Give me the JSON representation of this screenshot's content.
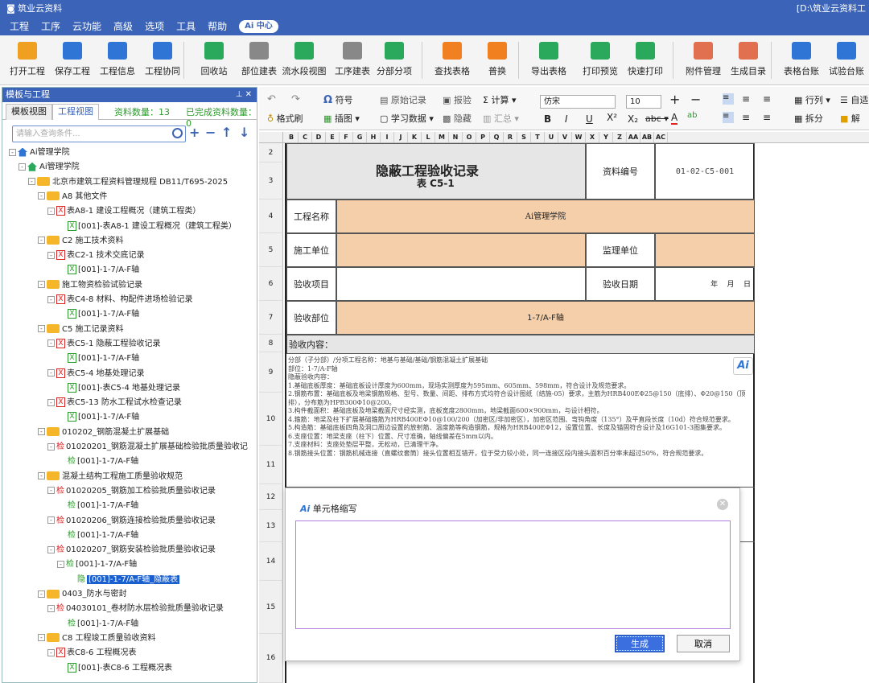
{
  "app": {
    "title": "筑业云资料",
    "path": "[D:\\筑业云资料工"
  },
  "menu": [
    "工程",
    "工序",
    "云功能",
    "高级",
    "选项",
    "工具",
    "帮助"
  ],
  "ai_center": "Ai 中心",
  "ribbon": [
    "打开工程",
    "保存工程",
    "工程信息",
    "工程协同",
    "回收站",
    "部位建表",
    "流水段视图",
    "工序建表",
    "分部分项",
    "查找表格",
    "普换",
    "导出表格",
    "打印预览",
    "快速打印",
    "附件管理",
    "生成目录",
    "表格台账",
    "试验台账"
  ],
  "left": {
    "title": "模板与工程",
    "tabs": [
      "模板视图",
      "工程视图"
    ],
    "count_label": "资料数量：13",
    "done_label": "已完成资料数量：0",
    "search_placeholder": "请输入查询条件...",
    "tree": [
      {
        "level": 0,
        "icon": "house-b",
        "tg": "-",
        "text": "Ai管理学院"
      },
      {
        "level": 1,
        "icon": "house",
        "tg": "-",
        "text": "Ai管理学院"
      },
      {
        "level": 2,
        "icon": "folder",
        "tg": "-",
        "text": "北京市建筑工程资料管理规程 DB11/T695-2025"
      },
      {
        "level": 3,
        "icon": "folder",
        "tg": "-",
        "text": "A8 其他文件"
      },
      {
        "level": 4,
        "icon": "x",
        "tg": "-",
        "text": "表A8-1 建设工程概况（建筑工程类）"
      },
      {
        "level": 5,
        "icon": "xg",
        "tg": "",
        "text": "[001]-表A8-1 建设工程概况（建筑工程类）"
      },
      {
        "level": 3,
        "icon": "folder",
        "tg": "-",
        "text": "C2 施工技术资料"
      },
      {
        "level": 4,
        "icon": "x",
        "tg": "-",
        "text": "表C2-1 技术交底记录"
      },
      {
        "level": 5,
        "icon": "xg",
        "tg": "",
        "text": "[001]-1-7/A-F轴"
      },
      {
        "level": 3,
        "icon": "folder",
        "tg": "-",
        "text": "施工物资检验试验记录"
      },
      {
        "level": 4,
        "icon": "x",
        "tg": "-",
        "text": "表C4-8 材料、构配件进场检验记录"
      },
      {
        "level": 5,
        "icon": "xg",
        "tg": "",
        "text": "[001]-1-7/A-F轴"
      },
      {
        "level": 3,
        "icon": "folder",
        "tg": "-",
        "text": "C5 施工记录资料"
      },
      {
        "level": 4,
        "icon": "x",
        "tg": "-",
        "text": "表C5-1 隐蔽工程验收记录"
      },
      {
        "level": 5,
        "icon": "xg",
        "tg": "",
        "text": "[001]-1-7/A-F轴"
      },
      {
        "level": 4,
        "icon": "x",
        "tg": "-",
        "text": "表C5-4 地基处理记录"
      },
      {
        "level": 5,
        "icon": "xg",
        "tg": "",
        "text": "[001]-表C5-4 地基处理记录"
      },
      {
        "level": 4,
        "icon": "x",
        "tg": "-",
        "text": "表C5-13 防水工程试水检查记录"
      },
      {
        "level": 5,
        "icon": "xg",
        "tg": "",
        "text": "[001]-1-7/A-F轴"
      },
      {
        "level": 3,
        "icon": "folder",
        "tg": "-",
        "text": "010202_钢筋混凝土扩展基础"
      },
      {
        "level": 4,
        "icon": "jian",
        "tg": "-",
        "text": "01020201_钢筋混凝土扩展基础检验批质量验收记"
      },
      {
        "level": 5,
        "icon": "jiang",
        "tg": "",
        "text": "[001]-1-7/A-F轴"
      },
      {
        "level": 3,
        "icon": "folder",
        "tg": "-",
        "text": "混凝土结构工程施工质量验收规范"
      },
      {
        "level": 4,
        "icon": "jian",
        "tg": "-",
        "text": "01020205_钢筋加工检验批质量验收记录"
      },
      {
        "level": 5,
        "icon": "jiang",
        "tg": "",
        "text": "[001]-1-7/A-F轴"
      },
      {
        "level": 4,
        "icon": "jian",
        "tg": "-",
        "text": "01020206_钢筋连接检验批质量验收记录"
      },
      {
        "level": 5,
        "icon": "jiang",
        "tg": "",
        "text": "[001]-1-7/A-F轴"
      },
      {
        "level": 4,
        "icon": "jian",
        "tg": "-",
        "text": "01020207_钢筋安装检验批质量验收记录"
      },
      {
        "level": 5,
        "icon": "jiang",
        "tg": "-",
        "text": "[001]-1-7/A-F轴"
      },
      {
        "level": 6,
        "icon": "yin",
        "tg": "",
        "text": "[001]-1-7/A-F轴_隐蔽表",
        "selected": true
      },
      {
        "level": 3,
        "icon": "folder",
        "tg": "-",
        "text": "0403_防水与密封"
      },
      {
        "level": 4,
        "icon": "jian",
        "tg": "-",
        "text": "04030101_卷材防水层检验批质量验收记录"
      },
      {
        "level": 5,
        "icon": "jiang",
        "tg": "",
        "text": "[001]-1-7/A-F轴"
      },
      {
        "level": 3,
        "icon": "folder",
        "tg": "-",
        "text": "C8 工程竣工质量验收资料"
      },
      {
        "level": 4,
        "icon": "x",
        "tg": "-",
        "text": "表C8-6 工程概况表"
      },
      {
        "level": 5,
        "icon": "xg",
        "tg": "",
        "text": "[001]-表C8-6 工程概况表"
      }
    ]
  },
  "toolbar2": {
    "symbol": "符号",
    "format_brush": "格式刷",
    "insert_image": "插图",
    "original_record": "原始记录",
    "inspection": "报验",
    "calc": "计算",
    "study_data": "学习数据",
    "hide": "隐藏",
    "summary": "汇总",
    "font": "仿宋",
    "size": "10",
    "rowcol": "行列",
    "auto": "自适",
    "split": "拆分",
    "unlock": "解"
  },
  "columns": [
    "B",
    "C",
    "D",
    "E",
    "F",
    "G",
    "H",
    "I",
    "J",
    "K",
    "L",
    "M",
    "N",
    "O",
    "P",
    "Q",
    "R",
    "S",
    "T",
    "U",
    "V",
    "W",
    "X",
    "Y",
    "Z",
    "AA",
    "AB",
    "AC"
  ],
  "rows": [
    "2",
    "3",
    "4",
    "5",
    "6",
    "7",
    "8",
    "9",
    "10",
    "11",
    "12",
    "13",
    "14",
    "15",
    "16"
  ],
  "form": {
    "title": "隐蔽工程验收记录",
    "subtitle": "表 C5-1",
    "doc_no_label": "资料编号",
    "doc_no": "01-02-C5-001",
    "project_label": "工程名称",
    "project": "Ai管理学院",
    "construct_label": "施工单位",
    "supervise_label": "监理单位",
    "item_label": "验收项目",
    "date_label": "验收日期",
    "date_value": "年    月    日",
    "part_label": "验收部位",
    "part": "1-7/A-F轴",
    "content_label": "验收内容：",
    "content": "分部（子分部）/分项工程名称：地基与基础/基础/钢筋混凝土扩展基础\n部位：1-7/A-F轴\n隐蔽验收内容：\n1.基础底板厚度：基础底板设计厚度为600mm，现场实测厚度为595mm、605mm、598mm，符合设计及规范要求。\n2.钢筋布置：基础底板及地梁钢筋规格、型号、数量、间距、排布方式均符合设计图纸（结施-05）要求，主筋为HRB400EΦ25@150（底排）、Φ20@150（顶排），分布筋为HPB300Φ10@200。\n3.构件截面积：基础底板及地梁截面尺寸经实测，底板宽度2800mm，地梁截面600×900mm，与设计相符。\n4.箍筋：地梁及柱下扩展基础箍筋为HRB400EΦ10@100/200（加密区/非加密区），加密区范围、弯钩角度（135°）及平直段长度（10d）符合规范要求。\n5.构造筋：基础底板四角及洞口周边设置的放射筋、温度筋等构造钢筋，规格为HRB400EΦ12，设置位置、长度及锚固符合设计及16G101-3图集要求。\n6.支座位置：地梁支座（柱下）位置、尺寸准确，轴线偏差在5mm以内。\n7.支座材料：支座处垫层平整，无松动，已清理干净。\n8.钢筋接头位置：钢筋机械连接（直螺纹套筒）接头位置相互错开，位于受力较小处，同一连接区段内接头面积百分率未超过50%，符合规范要求。"
  },
  "dialog": {
    "title": "单元格缩写",
    "ai": "Ai",
    "generate": "生成",
    "cancel": "取消"
  },
  "ai_badge": "Ai"
}
